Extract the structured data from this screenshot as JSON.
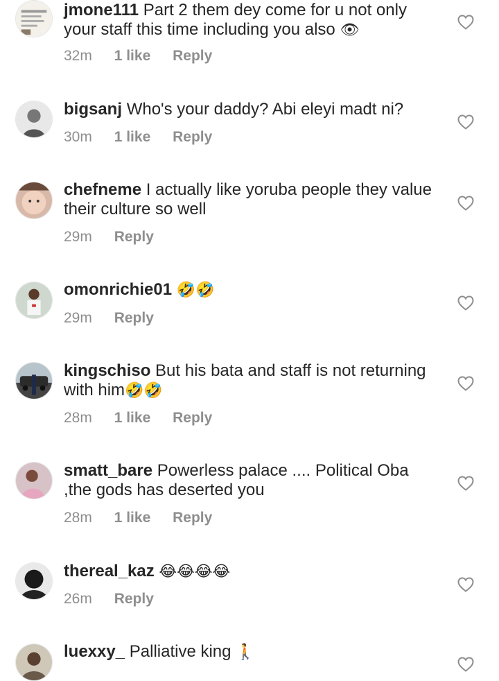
{
  "comments": [
    {
      "username": "jmone111",
      "text": "Part 2 them dey come for u not only your staff this time including you also",
      "emoji": "👁",
      "time": "32m",
      "likes": "1 like",
      "reply": "Reply",
      "avatar_icon": "text-post-avatar"
    },
    {
      "username": "bigsanj",
      "text": "Who's your daddy? Abi eleyi madt ni?",
      "emoji": "",
      "time": "30m",
      "likes": "1 like",
      "reply": "Reply",
      "avatar_icon": "man-avatar"
    },
    {
      "username": "chefneme",
      "text": "I actually like yoruba people they value their culture so well",
      "emoji": "",
      "time": "29m",
      "likes": "",
      "reply": "Reply",
      "avatar_icon": "baby-avatar"
    },
    {
      "username": "omonrichie01",
      "text": "",
      "emoji": "🤣🤣",
      "time": "29m",
      "likes": "",
      "reply": "Reply",
      "avatar_icon": "man-avatar"
    },
    {
      "username": "kingschiso",
      "text": "But his bata and staff is not returning with him",
      "emoji": "🤣🤣",
      "time": "28m",
      "likes": "1 like",
      "reply": "Reply",
      "avatar_icon": "car-avatar"
    },
    {
      "username": "smatt_bare",
      "text": "Powerless palace .... Political Oba ,the gods has deserted you",
      "emoji": "",
      "time": "28m",
      "likes": "1 like",
      "reply": "Reply",
      "avatar_icon": "person-avatar"
    },
    {
      "username": "thereal_kaz",
      "text": "",
      "emoji": "😂😂😂😂",
      "time": "26m",
      "likes": "",
      "reply": "Reply",
      "avatar_icon": "dark-avatar"
    },
    {
      "username": "luexxy_",
      "text": "Palliative king",
      "emoji": "🚶",
      "time": "",
      "likes": "",
      "reply": "",
      "avatar_icon": "person-avatar"
    }
  ],
  "colors": {
    "text": "#262626",
    "meta": "#8e8e8e",
    "heart": "#8e8e8e"
  }
}
